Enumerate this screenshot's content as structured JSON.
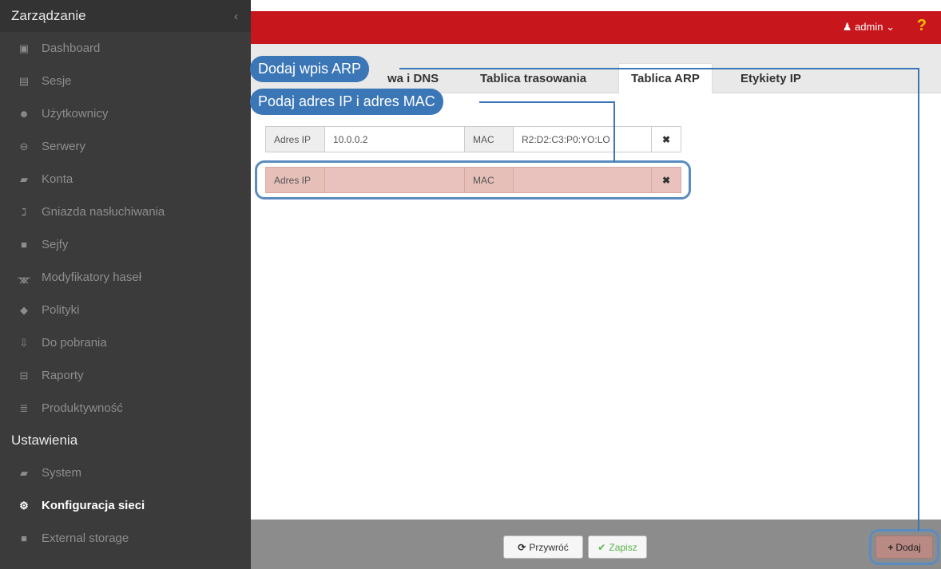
{
  "sidebar": {
    "title": "Zarządzanie",
    "collapse_glyph": "‹",
    "items": [
      {
        "label": "Dashboard",
        "icon": "dashboard-icon",
        "glyph": "▣"
      },
      {
        "label": "Sesje",
        "icon": "film-icon",
        "glyph": "▤"
      },
      {
        "label": "Użytkownicy",
        "icon": "users-icon",
        "glyph": "☻"
      },
      {
        "label": "Serwery",
        "icon": "server-icon",
        "glyph": "⊖"
      },
      {
        "label": "Konta",
        "icon": "credit-card-icon",
        "glyph": "▰"
      },
      {
        "label": "Gniazda nasłuchiwania",
        "icon": "rss-icon",
        "glyph": "ℷ"
      },
      {
        "label": "Sejfy",
        "icon": "safe-icon",
        "glyph": "■"
      },
      {
        "label": "Modyfikatory haseł",
        "icon": "sitemap-icon",
        "glyph": "ᚘ"
      },
      {
        "label": "Polityki",
        "icon": "shield-icon",
        "glyph": "◆"
      },
      {
        "label": "Do pobrania",
        "icon": "download-icon",
        "glyph": "⇩"
      },
      {
        "label": "Raporty",
        "icon": "print-icon",
        "glyph": "⊟"
      },
      {
        "label": "Produktywność",
        "icon": "list-icon",
        "glyph": "≣"
      }
    ],
    "section": "Ustawienia",
    "settings_items": [
      {
        "label": "System",
        "icon": "folder-open-icon",
        "glyph": "▰",
        "active": false
      },
      {
        "label": "Konfiguracja sieci",
        "icon": "cogs-icon",
        "glyph": "⚙",
        "active": true
      },
      {
        "label": "External storage",
        "icon": "folder-icon",
        "glyph": "■",
        "active": false
      }
    ]
  },
  "topbar": {
    "user": "admin",
    "user_glyph": "♟",
    "user_caret": "⌄",
    "help": "?",
    "color": "#c8161d"
  },
  "tabs": [
    {
      "label": "wa i DNS",
      "active": false
    },
    {
      "label": "Tablica trasowania",
      "active": false
    },
    {
      "label": "Tablica ARP",
      "active": true
    },
    {
      "label": "Etykiety IP",
      "active": false
    }
  ],
  "arp_rows": [
    {
      "ip_label": "Adres IP",
      "ip_value": "10.0.0.2",
      "mac_label": "MAC",
      "mac_value": "R2:D2:C3:P0:YO:LO",
      "remove": "✖"
    },
    {
      "ip_label": "Adres IP",
      "ip_value": "",
      "mac_label": "MAC",
      "mac_value": "",
      "remove": "✖"
    }
  ],
  "footer": {
    "revert_label": "Przywróć",
    "revert_glyph": "⟳",
    "save_label": "Zapisz",
    "save_glyph": "✔",
    "add_label": "Dodaj",
    "add_glyph": "+"
  },
  "callouts": {
    "add_entry": "Dodaj wpis ARP",
    "enter_ip_mac": "Podaj adres IP i adres MAC"
  },
  "colors": {
    "accent_blue": "#3b76b7",
    "highlight_row": "#eac2bd",
    "warning": "#f7c400"
  }
}
